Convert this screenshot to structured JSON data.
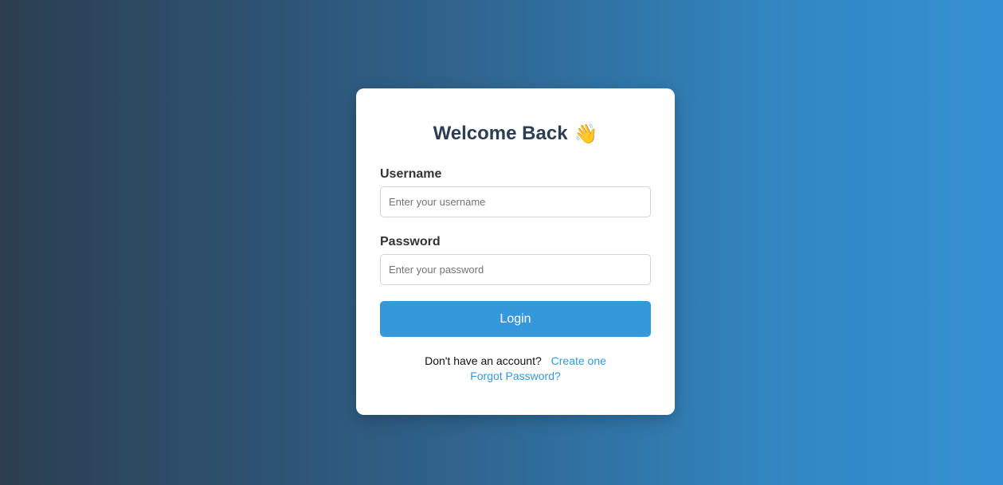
{
  "login_card": {
    "title": "Welcome Back",
    "title_emoji": "👋",
    "username": {
      "label": "Username",
      "placeholder": "Enter your username",
      "value": ""
    },
    "password": {
      "label": "Password",
      "placeholder": "Enter your password",
      "value": ""
    },
    "login_button_label": "Login",
    "signup_prompt": "Don't have an account?",
    "create_account_link": "Create one",
    "forgot_password_link": "Forgot Password?"
  },
  "colors": {
    "accent": "#3498db",
    "title": "#2c3e50",
    "background_gradient_start": "#2c3e50",
    "background_gradient_end": "#3490d3"
  },
  "icons": {
    "title_icon": "waving-hand-icon"
  }
}
